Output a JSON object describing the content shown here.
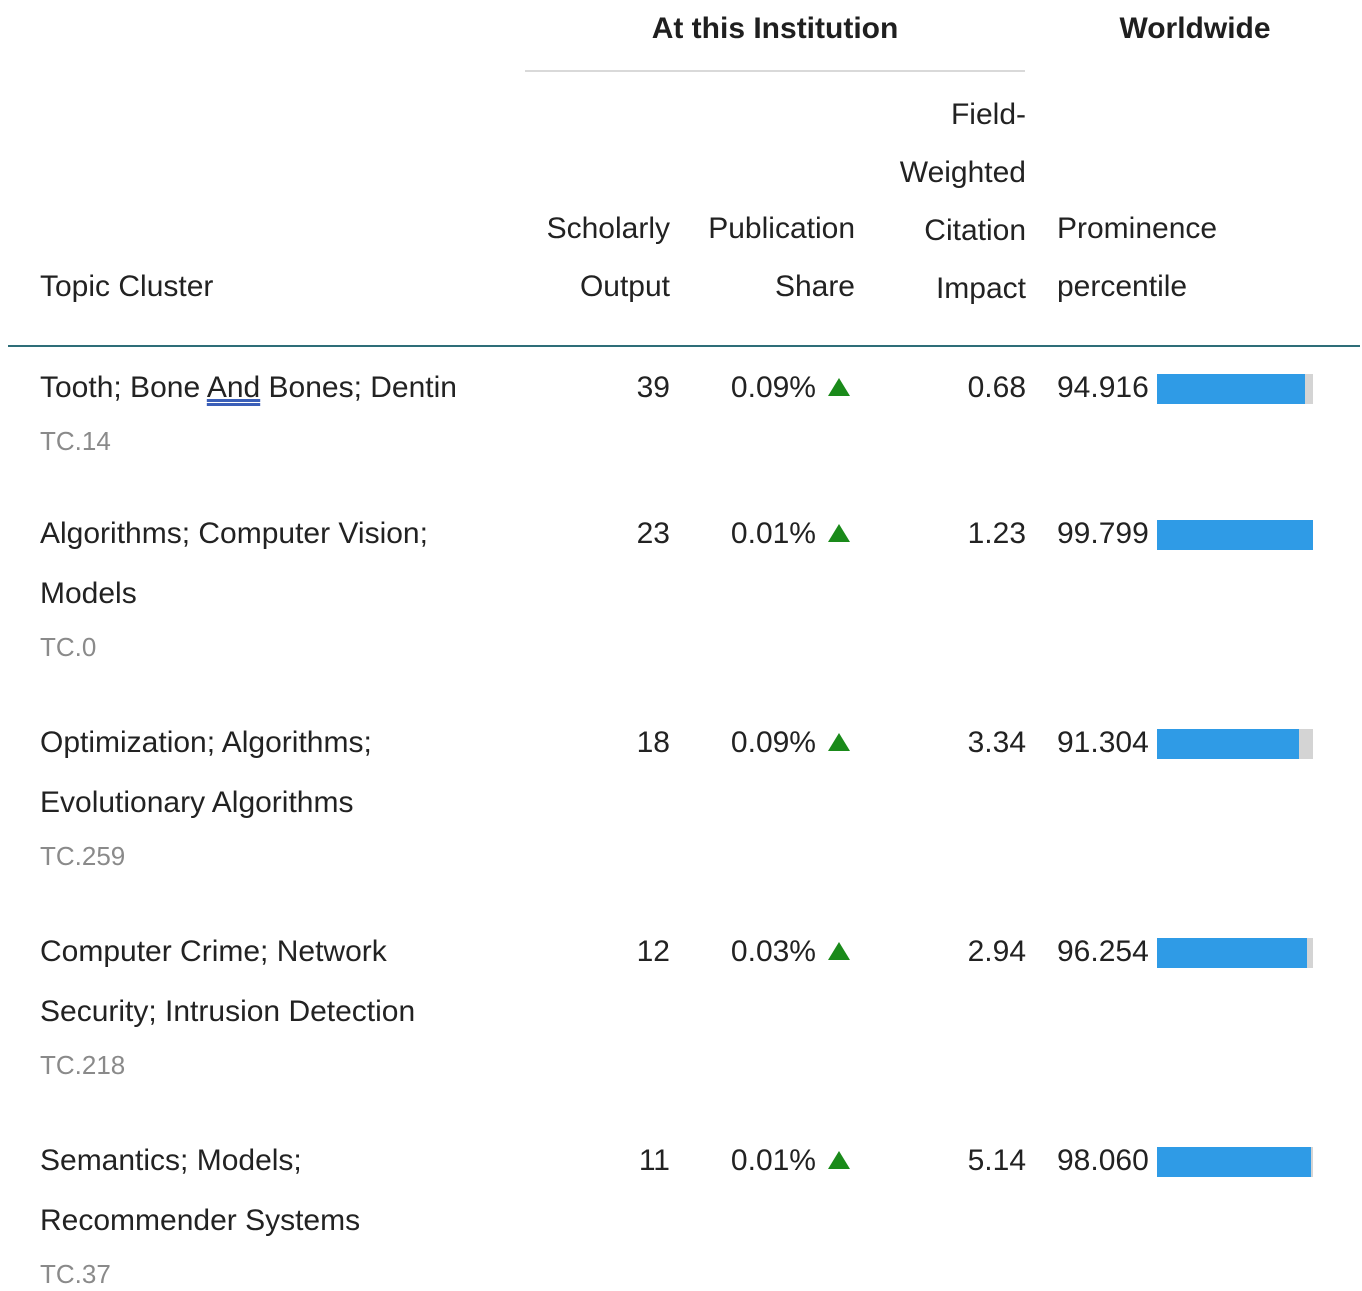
{
  "header": {
    "group_institution": "At this Institution",
    "group_worldwide": "Worldwide",
    "columns": {
      "topic": "Topic Cluster",
      "output": "Scholarly Output",
      "share": "Publication Share",
      "fwci": "Field-Weighted Citation Impact",
      "prominence": "Prominence percentile"
    }
  },
  "colors": {
    "bar_fill": "#2f9be6",
    "bar_track": "#d4d4d4",
    "up_arrow": "#1a8a1a",
    "header_rule": "#2e6e78",
    "code_text": "#8a8a8a"
  },
  "rows": [
    {
      "name_pre": "Tooth; Bone ",
      "name_and": "And",
      "name_post": " Bones; Dentin",
      "code": "TC.14",
      "output": "39",
      "share": "0.09%",
      "trend_icon": "up-triangle-icon",
      "fwci": "0.68",
      "prominence": "94.916",
      "prominence_bar_fraction": 0.95
    },
    {
      "name": "Algorithms; Computer Vision; Models",
      "code": "TC.0",
      "output": "23",
      "share": "0.01%",
      "trend_icon": "up-triangle-icon",
      "fwci": "1.23",
      "prominence": "99.799",
      "prominence_bar_fraction": 1.0
    },
    {
      "name": "Optimization; Algorithms; Evolutionary Algorithms",
      "code": "TC.259",
      "output": "18",
      "share": "0.09%",
      "trend_icon": "up-triangle-icon",
      "fwci": "3.34",
      "prominence": "91.304",
      "prominence_bar_fraction": 0.91
    },
    {
      "name": "Computer Crime; Network Security; Intrusion Detection",
      "code": "TC.218",
      "output": "12",
      "share": "0.03%",
      "trend_icon": "up-triangle-icon",
      "fwci": "2.94",
      "prominence": "96.254",
      "prominence_bar_fraction": 0.96
    },
    {
      "name": "Semantics; Models; Recommender Systems",
      "code": "TC.37",
      "output": "11",
      "share": "0.01%",
      "trend_icon": "up-triangle-icon",
      "fwci": "5.14",
      "prominence": "98.060",
      "prominence_bar_fraction": 0.99
    }
  ]
}
